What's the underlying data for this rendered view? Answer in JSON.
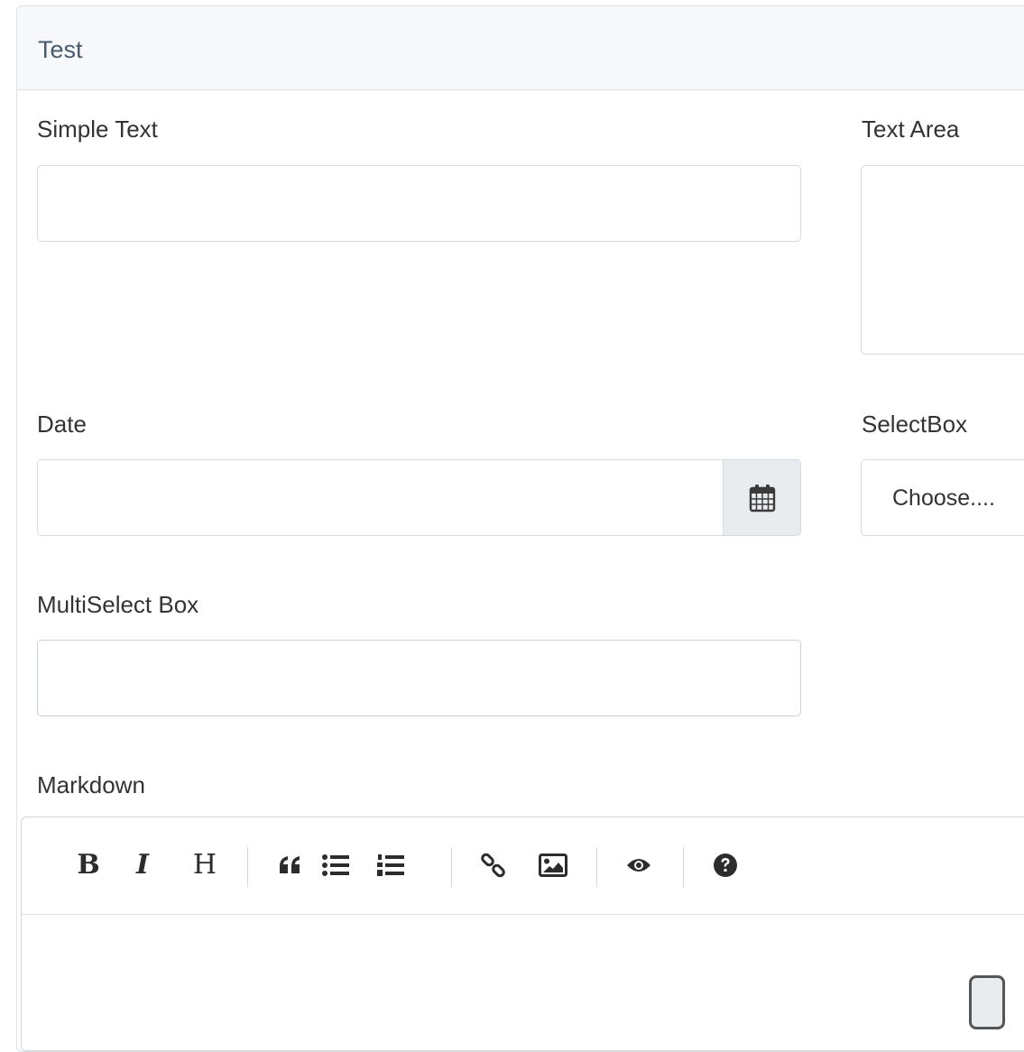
{
  "card": {
    "title": "Test"
  },
  "form": {
    "simple_text": {
      "label": "Simple Text",
      "value": "",
      "placeholder": ""
    },
    "text_area": {
      "label": "Text Area",
      "value": "",
      "placeholder": ""
    },
    "date": {
      "label": "Date",
      "value": "",
      "placeholder": ""
    },
    "select_box": {
      "label": "SelectBox",
      "selected": "Choose...."
    },
    "multi_select": {
      "label": "MultiSelect Box",
      "value": "",
      "placeholder": ""
    },
    "markdown": {
      "label": "Markdown",
      "toolbar": {
        "bold_label": "B",
        "italic_label": "I",
        "heading_label": "H",
        "icons": [
          "bold",
          "italic",
          "heading",
          "quote-icon",
          "unordered-list-icon",
          "ordered-list-icon",
          "link-icon",
          "image-icon",
          "eye-icon",
          "question-circle-icon"
        ]
      },
      "value": ""
    }
  },
  "colors": {
    "header_bg": "#f6f8fb",
    "border": "#d6dbe2",
    "addon_bg": "#e9ecef",
    "text": "#333333",
    "title_text": "#4a5a6a"
  }
}
